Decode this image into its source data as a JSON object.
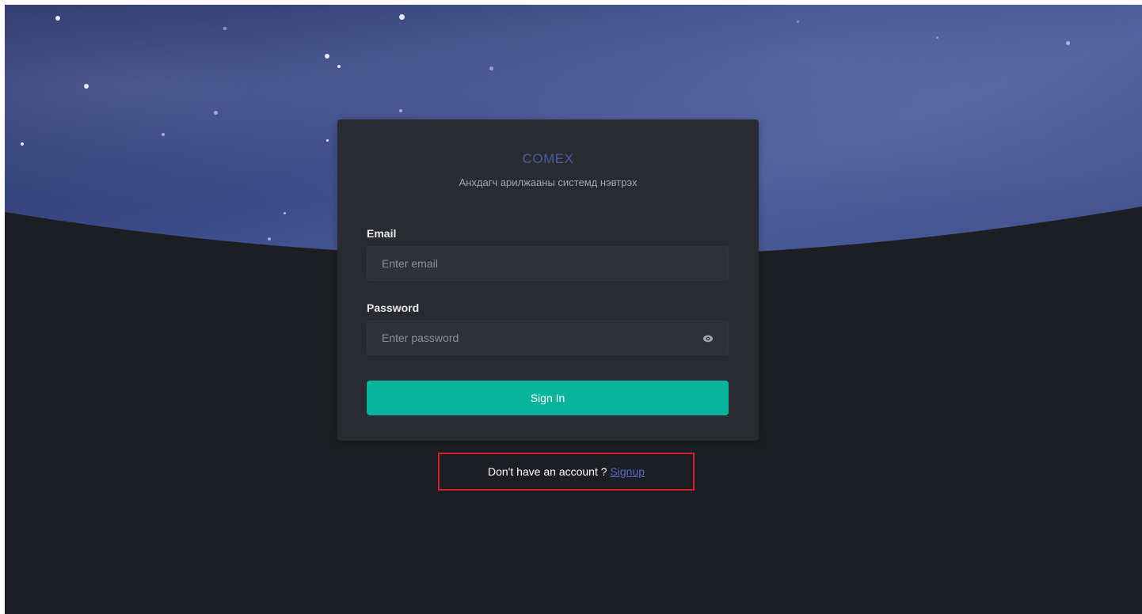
{
  "brand": {
    "name": "COMEX",
    "color": "#4f5aa6"
  },
  "subtitle": "Анхдагч арилжааны системд нэвтрэх",
  "form": {
    "email_label": "Email",
    "email_placeholder": "Enter email",
    "email_value": "",
    "password_label": "Password",
    "password_placeholder": "Enter password",
    "password_value": "",
    "password_toggle_icon": "eye-icon",
    "submit_label": "Sign In",
    "submit_color": "#0ab39c"
  },
  "footer": {
    "prompt": "Don't have an account ?",
    "signup_link": "Signup",
    "highlight_color": "#d42130"
  }
}
